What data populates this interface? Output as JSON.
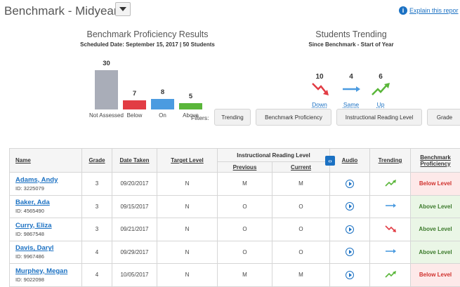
{
  "header": {
    "title": "Benchmark - Midyear",
    "explain_link": "Explain this repor"
  },
  "proficiency": {
    "title": "Benchmark Proficiency Results",
    "subtitle": "Scheduled Date: September 15, 2017  |  50 Students"
  },
  "chart_data": {
    "type": "bar",
    "categories": [
      "Not Assessed",
      "Below",
      "On",
      "Above"
    ],
    "values": [
      30,
      7,
      8,
      5
    ],
    "colors": [
      "#a9adb8",
      "#e23c44",
      "#4b9be0",
      "#5ab63a"
    ],
    "ylim": [
      0,
      30
    ]
  },
  "trending": {
    "title": "Students Trending",
    "subtitle": "Since Benchmark - Start of Year",
    "items": [
      {
        "label": "Down",
        "count": "10",
        "icon": "trend-down-icon",
        "color": "#e23c44"
      },
      {
        "label": "Same",
        "count": "4",
        "icon": "trend-same-icon",
        "color": "#4b9be0"
      },
      {
        "label": "Up",
        "count": "6",
        "icon": "trend-up-icon",
        "color": "#5ab63a"
      }
    ]
  },
  "filters": {
    "label": "Filters:",
    "buttons": [
      "Trending",
      "Benchmark Proficiency",
      "Instructional Reading Level",
      "Grade"
    ]
  },
  "table": {
    "headers": {
      "name": "Name",
      "grade": "Grade",
      "date_taken": "Date Taken",
      "target_level": "Target Level",
      "irl": "Instructional Reading Level",
      "previous": "Previous",
      "current": "Current",
      "audio": "Audio",
      "trending": "Trending",
      "benchmark": "Benchmark Proficiency"
    },
    "rows": [
      {
        "name": "Adams, Andy",
        "id": "ID: 3225079",
        "grade": "3",
        "date": "09/20/2017",
        "target": "N",
        "previous": "M",
        "current": "M",
        "trend": "up",
        "bench": "Below Level"
      },
      {
        "name": "Baker, Ada",
        "id": "ID: 4565490",
        "grade": "3",
        "date": "09/15/2017",
        "target": "N",
        "previous": "O",
        "current": "O",
        "trend": "same",
        "bench": "Above Level"
      },
      {
        "name": "Curry, Eliza",
        "id": "ID: 9867548",
        "grade": "3",
        "date": "09/21/2017",
        "target": "N",
        "previous": "O",
        "current": "O",
        "trend": "down",
        "bench": "Above Level"
      },
      {
        "name": "Davis, Daryl",
        "id": "ID: 9967486",
        "grade": "4",
        "date": "09/29/2017",
        "target": "N",
        "previous": "O",
        "current": "O",
        "trend": "same",
        "bench": "Above Level"
      },
      {
        "name": "Murphey, Megan",
        "id": "ID: 9022098",
        "grade": "4",
        "date": "10/05/2017",
        "target": "N",
        "previous": "M",
        "current": "M",
        "trend": "up",
        "bench": "Below Level"
      }
    ]
  }
}
